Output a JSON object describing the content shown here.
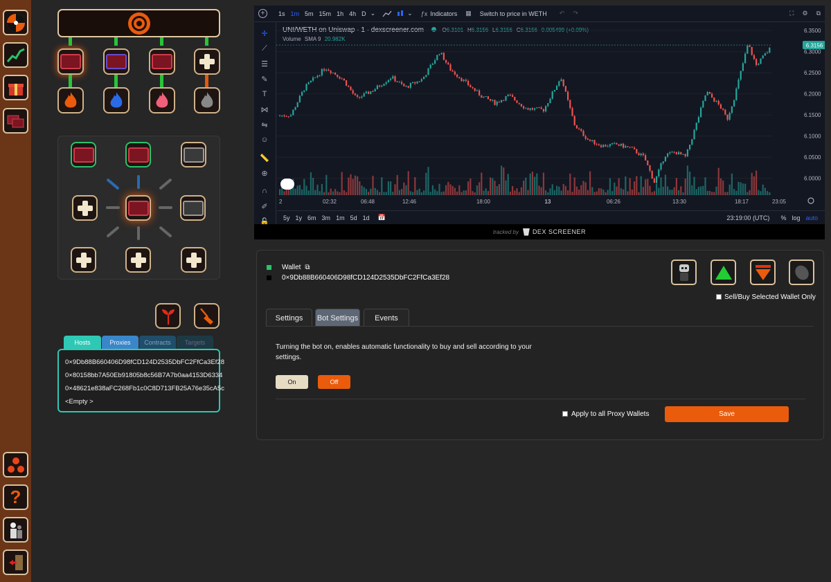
{
  "chart_header": {
    "intervals": [
      "1s",
      "1m",
      "5m",
      "15m",
      "1h",
      "4h",
      "D"
    ],
    "indicators_label": "Indicators",
    "switch_label": "Switch to price in WETH",
    "pair": "UNI/WETH on Uniswap · 1 · dexscreener.com",
    "ohlc": {
      "o_label": "O",
      "o": "6.3101",
      "h_label": "H",
      "h": "6.3156",
      "l_label": "L",
      "l": "6.3156",
      "c_label": "C",
      "c": "6.3156",
      "change": "0.005499 (+0.09%)"
    },
    "volume_label": "Volume",
    "volume_sma": "SMA 9",
    "volume_value": "20.982K",
    "price_badge": "6.3156",
    "price_ticks": [
      "6.3500",
      "6.3000",
      "6.2500",
      "6.2000",
      "6.1500",
      "6.1000",
      "6.0500",
      "6.0000"
    ],
    "time_ticks": [
      "2",
      "02:32",
      "06:48",
      "12:46",
      "18:00",
      "13",
      "06:26",
      "13:30",
      "18:17",
      "23:05"
    ],
    "ranges": [
      "5y",
      "1y",
      "6m",
      "3m",
      "1m",
      "5d",
      "1d"
    ],
    "clock": "23:19:00 (UTC)",
    "pct": "%",
    "log": "log",
    "auto": "auto",
    "tracked_by": "tracked by",
    "brand": "DEX SCREENER"
  },
  "chart_data": {
    "type": "candlestick",
    "series": "UNI/WETH",
    "y_range": [
      5.96,
      6.36
    ],
    "last_close": 6.3156,
    "colors": {
      "up": "#26a69a",
      "down": "#ef5350"
    }
  },
  "wallet": {
    "label": "Wallet",
    "address": "0×9Db88B660406D98fCD124D2535DbFC2FfCa3Ef28",
    "sell_buy_label": "Sell/Buy Selected Wallet Only"
  },
  "tabs": [
    "Settings",
    "Bot Settings",
    "Events"
  ],
  "bot": {
    "description": "Turning the bot on, enables automatic functionality to buy and sell according to your settings.",
    "on_label": "On",
    "off_label": "Off",
    "apply_label": "Apply to all Proxy Wallets",
    "save_label": "Save"
  },
  "list_tabs": [
    "Hosts",
    "Proxies",
    "Contracts",
    "Targets"
  ],
  "hosts": [
    "0×9Db88B660406D98fCD124D2535DbFC2FfCa3Ef28",
    "0×80158bb7A50Eb91805b8c56B7A7b0aa4153D6334",
    "0×48621e838aFC268Fb1c0C8D713FB25A76e35cA5c",
    "<Empty >"
  ],
  "colors": {
    "accent": "#ea5b0c",
    "sidebar": "#6b3517",
    "teal": "#2fc8b5",
    "up": "#26a69a",
    "down": "#ef5350"
  }
}
